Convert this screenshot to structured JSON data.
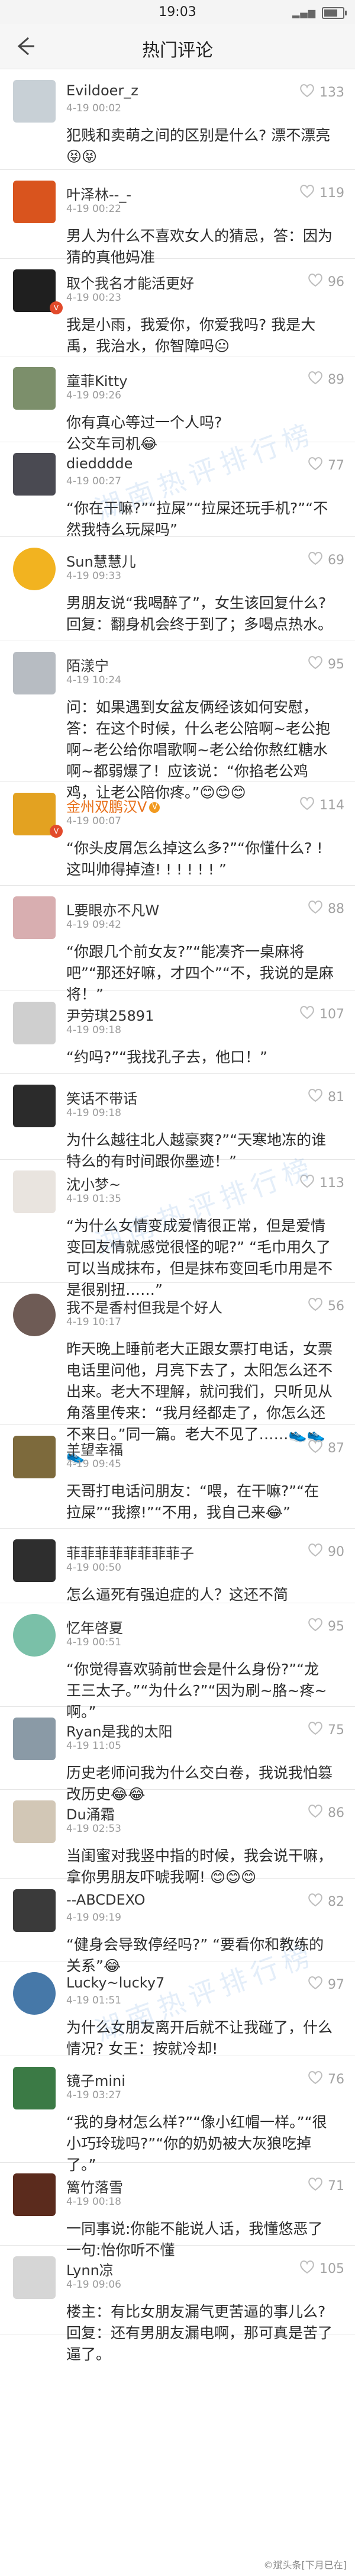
{
  "status_bar": {
    "time": "19:03",
    "signal": "▂▄▆"
  },
  "header": {
    "title": "热门评论"
  },
  "comments": [
    {
      "user": "Evildoer_z",
      "date": "4-19 00:02",
      "likes": "133",
      "avatar_color": "#c8d0d6",
      "text": "犯贱和卖萌之间的区别是什么? 漂不漂亮😝😝"
    },
    {
      "user": "叶泽林--_-",
      "date": "4-19 00:22",
      "likes": "119",
      "avatar_color": "#d9541e",
      "text": "男人为什么不喜欢女人的猜忌，答：因为猜的真他妈准"
    },
    {
      "user": "取个我名才能活更好",
      "date": "4-19 00:23",
      "likes": "96",
      "avatar_color": "#1f1f1f",
      "text": "我是小雨，我爱你，你爱我吗? 我是大禹，我治水，你智障吗😐"
    },
    {
      "user": "童菲Kitty",
      "date": "4-19 09:26",
      "likes": "89",
      "avatar_color": "#7c8f6b",
      "text": "你有真心等过一个人吗?\n公交车司机😂"
    },
    {
      "user": "diedddde",
      "date": "4-19 00:27",
      "likes": "77",
      "avatar_color": "#4a4a52",
      "text": "“你在干嘛?”“拉屎”“拉屎还玩手机?”“不然我特么玩屎吗”"
    },
    {
      "user": "Sun慧慧儿",
      "date": "4-19 09:33",
      "likes": "69",
      "avatar_color": "#f2b320",
      "text": "男朋友说“我喝醉了”，女生该回复什么? 回复：翻身机会终于到了；多喝点热水。"
    },
    {
      "user": "陌漾宁",
      "date": "4-19 10:24",
      "likes": "95",
      "avatar_color": "#b7bcc2",
      "text": "问：如果遇到女盆友俩经该如何安慰，答：在这个时候，什么老公陪啊~老公抱啊~老公给你唱歌啊~老公给你熬红糖水啊~都弱爆了！应该说：“你掐老公鸡鸡，让老公陪你疼。”😊😊😊"
    },
    {
      "user": "金州双鹏汉V",
      "date": "4-19 00:07",
      "likes": "114",
      "avatar_color": "#e3a221",
      "text": "“你头皮屑怎么掉这么多?”“你懂什么? ! 这叫帅得掉渣! ! ! ! ! ! ”",
      "orange": true
    },
    {
      "user": "L要眼亦不凡W",
      "date": "4-19 09:42",
      "likes": "88",
      "avatar_color": "#d8aeb0",
      "text": "“你跟几个前女友?”“能凑齐一桌麻将吧”“那还好嘛，才四个”“不，我说的是麻将！”"
    },
    {
      "user": "尹劳琪25891",
      "date": "4-19 09:18",
      "likes": "107",
      "avatar_color": "#cfcfcf",
      "text": "“约吗?”“我找孔子去，他口！”"
    },
    {
      "user": "笑话不带话",
      "date": "4-19 09:18",
      "likes": "81",
      "avatar_color": "#2b2b2b",
      "text": "为什么越往北人越豪爽?”“天寒地冻的谁特么的有时间跟你墨迹！”"
    },
    {
      "user": "沈小梦~",
      "date": "4-19 01:35",
      "likes": "113",
      "avatar_color": "#e9e4df",
      "text": "“为什么女情变成爱情很正常，但是爱情变回友情就感觉很怪的呢?” “毛巾用久了可以当成抹布，但是抹布变回毛巾用是不是很别扭……”"
    },
    {
      "user": "我不是香村但我是个好人",
      "date": "4-19 10:17",
      "likes": "56",
      "avatar_color": "#6e5b55",
      "text": "昨天晚上睡前老大正跟女票打电话，女票电话里问他，月亮下去了，太阳怎么还不出来。老大不理解，就问我们，只听见从角落里传来：“我月经都走了，你怎么还不来日。”同一篇。老大不见了……👟👟👟"
    },
    {
      "user": "羊望幸福",
      "date": "4-19 09:45",
      "likes": "87",
      "avatar_color": "#7d6a3c",
      "text": "天哥打电话问朋友：“喂，在干嘛?”“在拉屎”“我擦!”“不用，我自己来😂”"
    },
    {
      "user": "菲菲菲菲菲菲菲菲子",
      "date": "4-19 00:50",
      "likes": "90",
      "avatar_color": "#2e2e2e",
      "text": "怎么逼死有强迫症的人？这还不简"
    },
    {
      "user": "忆年啓夏",
      "date": "4-19 00:51",
      "likes": "95",
      "avatar_color": "#7ac0a8",
      "text": "“你觉得喜欢骑前世会是什么身份?”“龙王三太子。”“为什么?”“因为刷~胳~疼~啊。”"
    },
    {
      "user": "Ryan是我的太阳",
      "date": "4-19 11:05",
      "likes": "75",
      "avatar_color": "#8a9aa6",
      "text": "历史老师问我为什么交白卷，我说我怕篡改历史😂😂"
    },
    {
      "user": "Du涌霜",
      "date": "4-19 02:53",
      "likes": "86",
      "avatar_color": "#d2c7b6",
      "text": "当闺蜜对我竖中指的时候，我会说干嘛，拿你男朋友吓唬我啊! 😊😊😊"
    },
    {
      "user": "--ABCDEXO",
      "date": "4-19 09:19",
      "likes": "82",
      "avatar_color": "#3a3a3a",
      "text": "“健身会导致停经吗?” “要看你和教练的关系”😂"
    },
    {
      "user": "Lucky~lucky7",
      "date": "4-19 01:51",
      "likes": "97",
      "avatar_color": "#4678a8",
      "text": "为什么女朋友离开后就不让我碰了，什么情况? 女王：按就冷却!"
    },
    {
      "user": "镜子mini",
      "date": "4-19 03:27",
      "likes": "76",
      "avatar_color": "#3b7a45",
      "text": "“我的身材怎么样?”“像小红帽一样。”“很小巧玲珑吗?”“你的奶奶被大灰狼吃掉了。”"
    },
    {
      "user": "篱竹落雪",
      "date": "4-19 00:18",
      "likes": "71",
      "avatar_color": "#5b2b1d",
      "text": "一同事说:你能不能说人话，我懂悠恶了一句:怡你听不懂"
    },
    {
      "user": "Lynn凉",
      "date": "4-19 09:06",
      "likes": "105",
      "avatar_color": "#d6d6d6",
      "text": "楼主：有比女朋友漏气更苦逼的事儿么? 回复：还有男朋友漏电啊，那可真是苦了逼了。"
    }
  ],
  "watermark": {
    "text": "湖南热评排行榜"
  },
  "footer": {
    "credit": "©斌头条[下月已在]"
  }
}
